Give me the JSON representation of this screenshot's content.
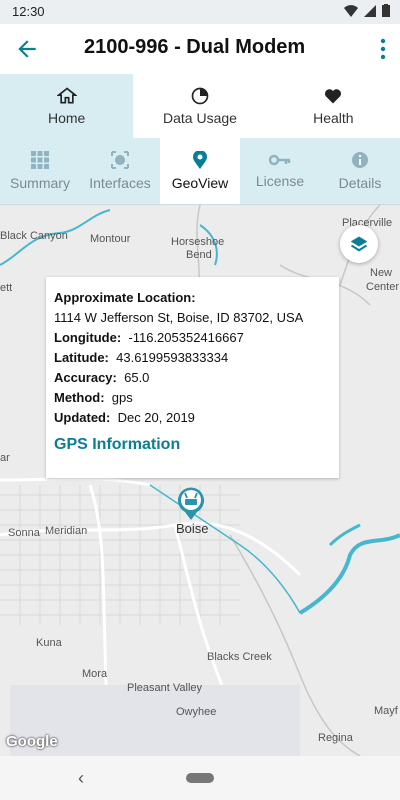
{
  "status_bar": {
    "time": "12:30"
  },
  "app_bar": {
    "title": "2100-996 - Dual Modem"
  },
  "top_tabs": [
    {
      "label": "Home",
      "icon": "home-icon",
      "active": true
    },
    {
      "label": "Data Usage",
      "icon": "pie-chart-icon",
      "active": false
    },
    {
      "label": "Health",
      "icon": "heart-icon",
      "active": false
    }
  ],
  "sub_tabs": [
    {
      "label": "Summary",
      "icon": "grid-icon",
      "active": false
    },
    {
      "label": "Interfaces",
      "icon": "interfaces-icon",
      "active": false
    },
    {
      "label": "GeoView",
      "icon": "location-pin-icon",
      "active": true
    },
    {
      "label": "License",
      "icon": "key-icon",
      "active": false
    },
    {
      "label": "Details",
      "icon": "info-icon",
      "active": false
    }
  ],
  "map": {
    "labels": {
      "black_canyon": "Black Canyon",
      "montour": "Montour",
      "horseshoe_bend_1": "Horseshoe",
      "horseshoe_bend_2": "Bend",
      "placerville": "Placerville",
      "new_centerville_1": "New",
      "new_centerville_2": "Center",
      "emmett": "ett",
      "left_edge": "ar",
      "sonna": "Sonna",
      "meridian": "Meridian",
      "boise": "Boise",
      "kuna": "Kuna",
      "mora": "Mora",
      "blacks_creek": "Blacks Creek",
      "pleasant_valley": "Pleasant Valley",
      "owyhee": "Owyhee",
      "mayfield": "Mayf",
      "regina": "Regina"
    },
    "attribution": "Google"
  },
  "info_window": {
    "approx_location_label": "Approximate Location:",
    "address": "1114 W Jefferson St, Boise, ID 83702, USA",
    "longitude_label": "Longitude:",
    "longitude": "-116.205352416667",
    "latitude_label": "Latitude:",
    "latitude": "43.6199593833334",
    "accuracy_label": "Accuracy:",
    "accuracy": "65.0",
    "method_label": "Method:",
    "method": "gps",
    "updated_label": "Updated:",
    "updated": "Dec 20, 2019",
    "gps_link": "GPS Information"
  },
  "colors": {
    "accent": "#0a7e95",
    "tab_bg": "#d8edf1",
    "water": "#48b6d0"
  }
}
